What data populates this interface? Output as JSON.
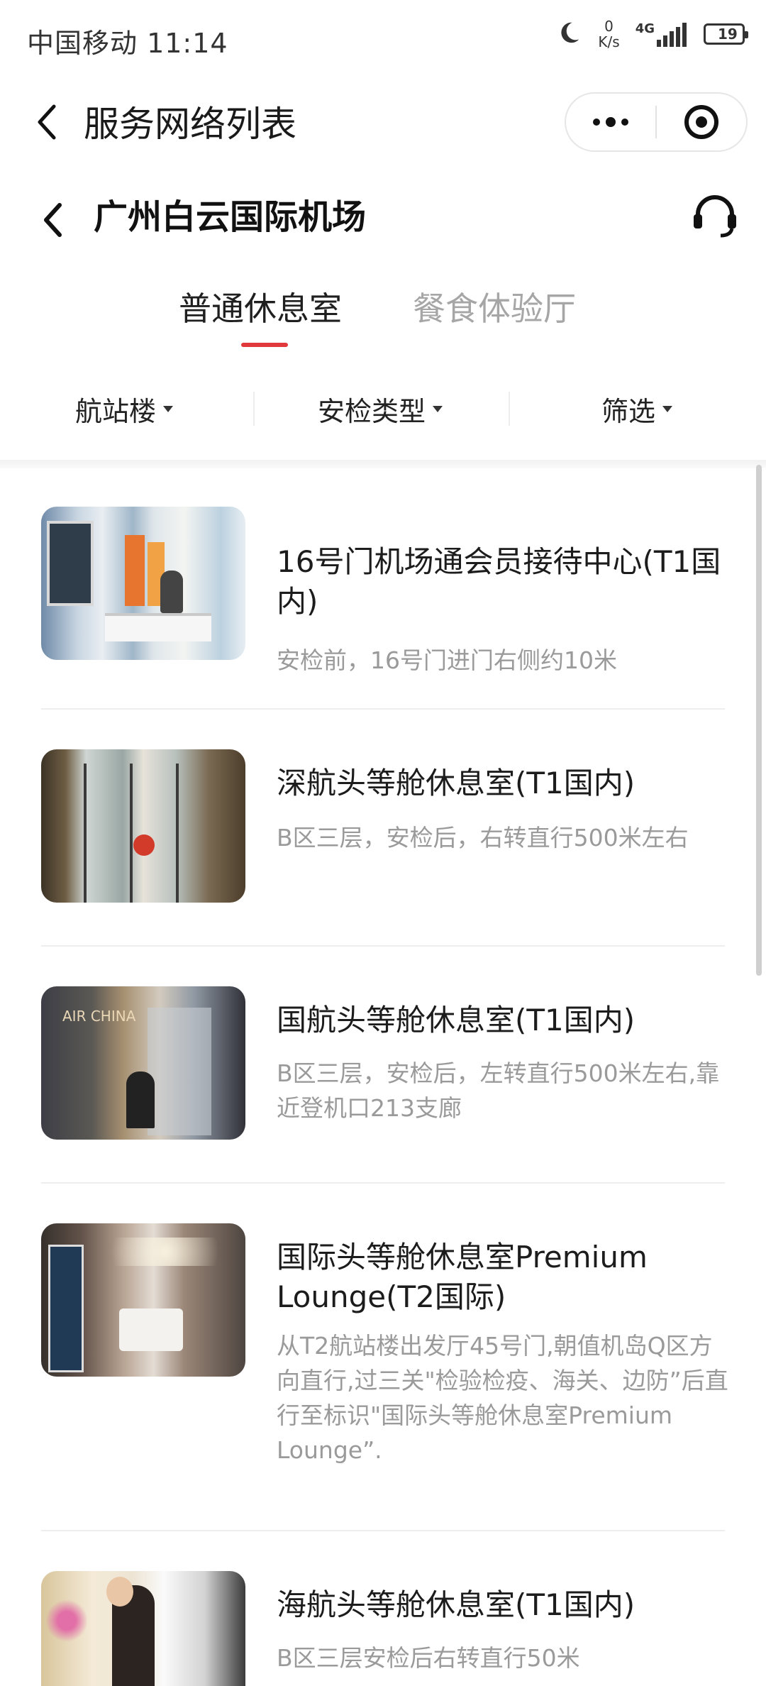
{
  "status_bar": {
    "carrier_time": "中国移动 11:14",
    "speed_value": "0",
    "speed_unit": "K/s",
    "network": "4G",
    "battery": "19",
    "battery_level": 0.19
  },
  "nav_bar": {
    "title": "服务网络列表"
  },
  "header": {
    "title": "广州白云国际机场"
  },
  "tabs": [
    {
      "label": "普通休息室",
      "active": true
    },
    {
      "label": "餐食体验厅",
      "active": false
    }
  ],
  "filters": [
    {
      "label": "航站楼"
    },
    {
      "label": "安检类型"
    },
    {
      "label": "筛选"
    }
  ],
  "lounges": [
    {
      "title": "16号门机场通会员接待中心(T1国内)",
      "desc": "安检前，16号门进门右侧约10米"
    },
    {
      "title": "深航头等舱休息室(T1国内)",
      "desc": "B区三层，安检后，右转直行500米左右"
    },
    {
      "title": "国航头等舱休息室(T1国内)",
      "desc": "B区三层，安检后，左转直行500米左右,靠近登机口213支廊"
    },
    {
      "title": "国际头等舱休息室Premium Lounge(T2国际)",
      "desc": "从T2航站楼出发厅45号门,朝值机岛Q区方向直行,过三关\"检验检疫、海关、边防”后直行至标识\"国际头等舱休息室Premium Lounge”."
    },
    {
      "title": "海航头等舱休息室(T1国内)",
      "desc": "B区三层安检后右转直行50米"
    }
  ],
  "colors": {
    "accent": "#e0383b",
    "inactive_tab": "#a6a6a6",
    "description": "#9a9a9a"
  },
  "icons": [
    "back-arrow-icon",
    "more-dots-icon",
    "target-close-icon",
    "customer-service-icon",
    "dropdown-caret-icon",
    "moon-icon",
    "signal-icon"
  ]
}
